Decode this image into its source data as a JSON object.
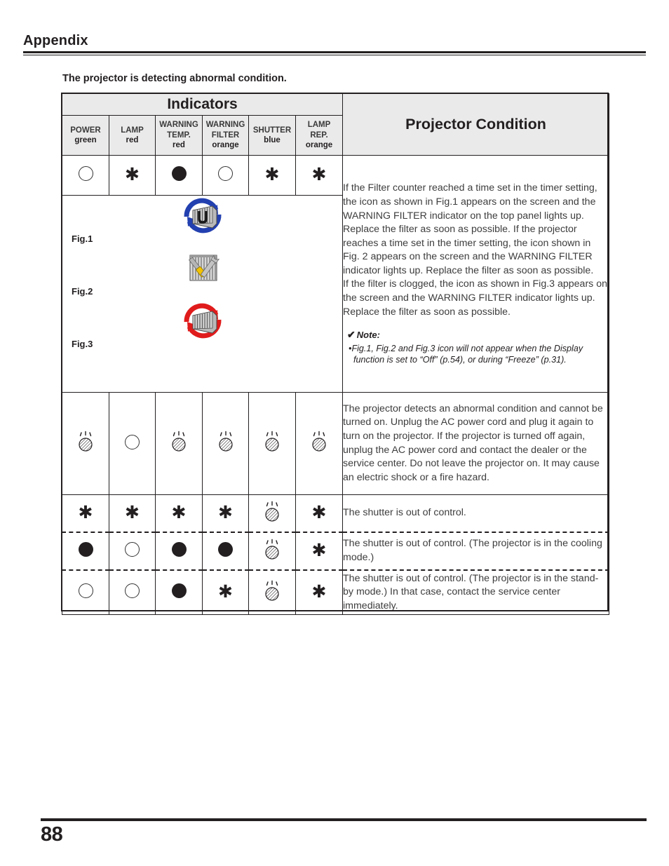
{
  "page": {
    "chapter_title": "Appendix",
    "page_number": "88",
    "section_heading": "The projector is detecting abnormal condition."
  },
  "table": {
    "indicators_group_label": "Indicators",
    "projector_condition_label": "Projector Condition",
    "columns": [
      {
        "name": "POWER",
        "color": "green"
      },
      {
        "name": "LAMP",
        "color": "red"
      },
      {
        "name": "WARNING TEMP.",
        "name_line1": "WARNING",
        "name_line2": "TEMP.",
        "color": "red"
      },
      {
        "name": "WARNING FILTER",
        "name_line1": "WARNING",
        "name_line2": "FILTER",
        "color": "orange"
      },
      {
        "name": "SHUTTER",
        "color": "blue"
      },
      {
        "name": "LAMP REP.",
        "name_line1": "LAMP",
        "name_line2": "REP.",
        "color": "orange"
      }
    ],
    "rows": [
      {
        "id": "filter-warning",
        "states": [
          "off",
          "blink",
          "on",
          "off",
          "blink",
          "blink"
        ],
        "description": "If the Filter counter reached a time set in the timer setting, the icon as shown in Fig.1 appears on the screen and the WARNING FILTER indicator on the top panel lights up. Replace the filter as soon as possible. If the projector reaches a time set in the timer setting, the icon shown in Fig. 2 appears on the screen and the WARNING FILTER indicator lights up. Replace the filter as soon as possible.",
        "description2": "If the filter is clogged, the icon as shown in Fig.3 appears on the screen and the WARNING FILTER indicator lights up. Replace the filter as soon as possible.",
        "note": {
          "title": "Note:",
          "check": "✔",
          "bullet": "•",
          "text": "Fig.1, Fig.2 and Fig.3 icon will not appear when the Display function is set to “Off” (p.54), or during “Freeze” (p.31)."
        },
        "figures": [
          {
            "label": "Fig.1",
            "icon": "filter-rotate-blue-icon"
          },
          {
            "label": "Fig.2",
            "icon": "filter-tools-icon"
          },
          {
            "label": "Fig.3",
            "icon": "filter-rotate-red-icon"
          }
        ]
      },
      {
        "id": "abnormal-condition",
        "states": [
          "blinking",
          "off",
          "blinking",
          "blinking",
          "blinking",
          "blinking"
        ],
        "description": "The projector detects an abnormal condition and cannot be turned on. Unplug the AC power cord and plug it again to turn on the projector. If the projector is turned off again, unplug the AC power cord and contact the dealer or the service center. Do not leave the projector on. It may cause an electric shock or a fire hazard."
      },
      {
        "id": "shutter-out-of-control-1",
        "states": [
          "blink",
          "blink",
          "blink",
          "blink",
          "blinking",
          "blink"
        ],
        "description": "The shutter is out of control."
      },
      {
        "id": "shutter-out-of-control-cooling",
        "states": [
          "on",
          "off",
          "on",
          "on",
          "blinking",
          "blink"
        ],
        "description": "The shutter is out of control. (The projector is in the cooling mode.)"
      },
      {
        "id": "shutter-out-of-control-standby",
        "states": [
          "off",
          "off",
          "on",
          "blink",
          "blinking",
          "blink"
        ],
        "description": "The shutter is out of control. (The projector is in the stand-by mode.) In that case, contact the service center immediately."
      }
    ]
  },
  "glyph_legend": {
    "off": "indicator-off-icon",
    "on": "indicator-on-icon",
    "blink": "indicator-blink-asterisk-icon",
    "blinking": "indicator-blinking-hatched-icon",
    "asterisk_char": "✱"
  },
  "colors": {
    "ink": "#231f20",
    "header_fill": "#eaeaea",
    "body_text": "#3d3d3d",
    "fig1_arrow": "#2340b0",
    "fig3_arrow": "#e01b1b"
  }
}
